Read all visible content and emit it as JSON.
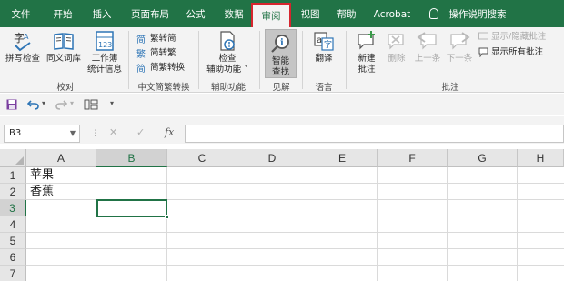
{
  "tabs": [
    {
      "label": "文件",
      "active": false
    },
    {
      "label": "开始",
      "active": false
    },
    {
      "label": "插入",
      "active": false
    },
    {
      "label": "页面布局",
      "active": false
    },
    {
      "label": "公式",
      "active": false
    },
    {
      "label": "数据",
      "active": false
    },
    {
      "label": "审阅",
      "active": true
    },
    {
      "label": "视图",
      "active": false
    },
    {
      "label": "帮助",
      "active": false
    },
    {
      "label": "Acrobat",
      "active": false
    },
    {
      "label": "操作说明搜索",
      "active": false
    }
  ],
  "ribbon": {
    "proofing": {
      "label": "校对",
      "spell_check": "拼写检查",
      "thesaurus": "同义词库",
      "workbook_stats_line1": "工作簿",
      "workbook_stats_line2": "统计信息"
    },
    "chinese_conversion": {
      "label": "中文简繁转换",
      "to_traditional": "繁转简",
      "to_simplified": "简转繁",
      "convert": "简繁转换"
    },
    "accessibility": {
      "label": "辅助功能",
      "check_line1": "检查",
      "check_line2": "辅助功能 ˅"
    },
    "insights": {
      "label": "见解",
      "smart_lookup_line1": "智能",
      "smart_lookup_line2": "查找"
    },
    "language": {
      "label": "语言",
      "translate": "翻译"
    },
    "comments": {
      "label": "批注",
      "new_comment_line1": "新建",
      "new_comment_line2": "批注",
      "delete": "删除",
      "previous": "上一条",
      "next": "下一条",
      "show_hide": "显示/隐藏批注",
      "show_all": "显示所有批注"
    }
  },
  "formula_bar": {
    "name_box": "B3",
    "cancel_glyph": "✕",
    "enter_glyph": "✓",
    "fx_label": "fx",
    "formula": ""
  },
  "sheet": {
    "columns": [
      "A",
      "B",
      "C",
      "D",
      "E",
      "F",
      "G",
      "H"
    ],
    "rows": [
      "1",
      "2",
      "3",
      "4",
      "5",
      "6",
      "7"
    ],
    "selected_cell": "B3",
    "cells": {
      "A1": "苹果",
      "A2": "香蕉"
    }
  },
  "colors": {
    "accent": "#217346",
    "active_tab_outline": "#d6252e"
  }
}
